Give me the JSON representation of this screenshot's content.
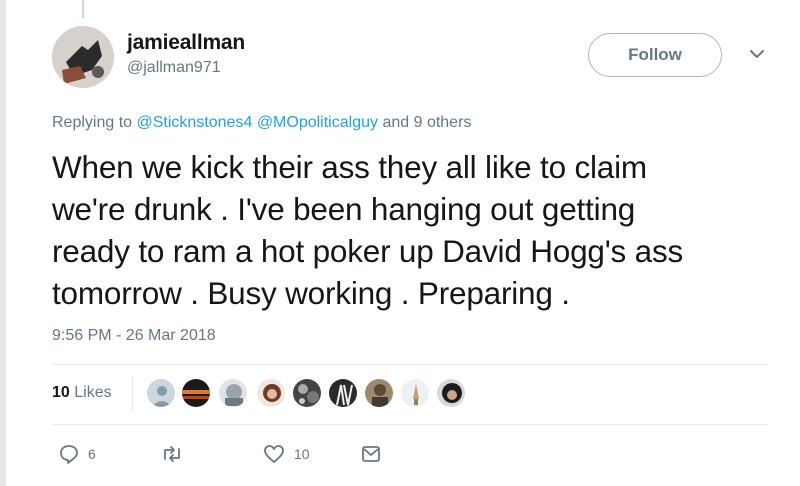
{
  "tweet": {
    "author": {
      "display_name": "jamieallman",
      "handle": "@jallman971",
      "avatar_icon": "profile-photo"
    },
    "follow_label": "Follow",
    "reply_context": {
      "prefix": "Replying to",
      "mentions": [
        "@Sticknstones4",
        "@MOpoliticalguy"
      ],
      "and_text": "and",
      "others": "9 others"
    },
    "text_lines": [
      "When we kick their ass they all like to claim",
      "we're drunk . I've been hanging out getting",
      "ready to ram a hot poker up David Hogg's ass",
      "tomorrow . Busy working . Preparing ."
    ],
    "timestamp": "9:56 PM - 26 Mar 2018",
    "likes": {
      "count": "10",
      "label": "Likes",
      "liker_avatars": 10
    },
    "actions": {
      "reply_count": "6",
      "retweet_count": "",
      "like_count": "10"
    }
  },
  "colors": {
    "text_primary": "#14171a",
    "text_secondary": "#657786",
    "link": "#1da1f2",
    "divider": "#e6ecf0"
  }
}
